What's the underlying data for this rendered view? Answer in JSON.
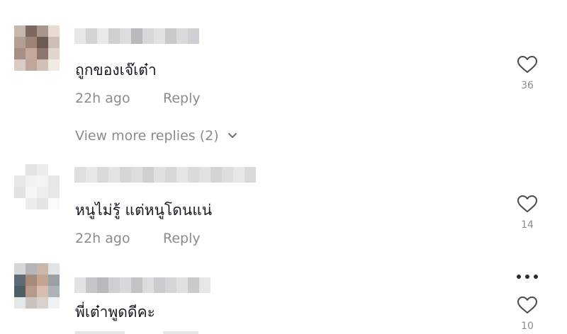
{
  "comments": [
    {
      "text": "ถูกของเจ๊เต๋า",
      "time": "22h ago",
      "reply_label": "Reply",
      "likes": "36",
      "view_more": "View more replies (2)"
    },
    {
      "text": "หนูไม่รู้ แต่หนูโดนแน่",
      "time": "22h ago",
      "reply_label": "Reply",
      "likes": "14"
    },
    {
      "text": "พี่เต๋าพูดดีคะ",
      "likes": "10"
    }
  ],
  "icons": {
    "like": "heart-outline-icon",
    "expand": "chevron-down-icon",
    "more": "more-horizontal-icon"
  },
  "colors": {
    "text": "#161823",
    "muted": "#8a8b91"
  }
}
